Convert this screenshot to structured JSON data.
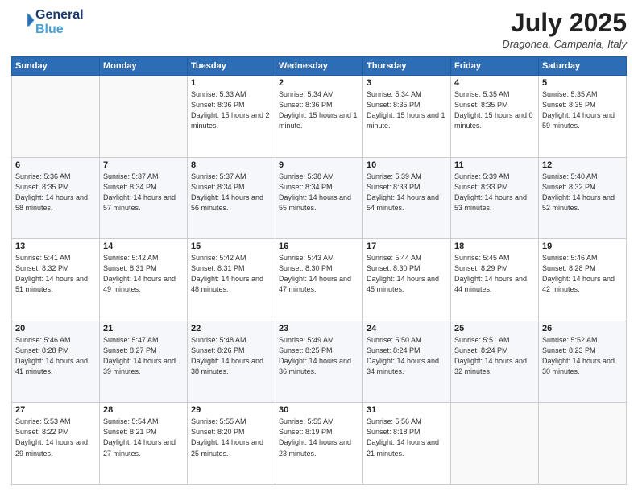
{
  "logo": {
    "line1": "General",
    "line2": "Blue"
  },
  "title": "July 2025",
  "location": "Dragonea, Campania, Italy",
  "days_of_week": [
    "Sunday",
    "Monday",
    "Tuesday",
    "Wednesday",
    "Thursday",
    "Friday",
    "Saturday"
  ],
  "weeks": [
    [
      {
        "day": "",
        "info": ""
      },
      {
        "day": "",
        "info": ""
      },
      {
        "day": "1",
        "info": "Sunrise: 5:33 AM\nSunset: 8:36 PM\nDaylight: 15 hours\nand 2 minutes."
      },
      {
        "day": "2",
        "info": "Sunrise: 5:34 AM\nSunset: 8:36 PM\nDaylight: 15 hours\nand 1 minute."
      },
      {
        "day": "3",
        "info": "Sunrise: 5:34 AM\nSunset: 8:35 PM\nDaylight: 15 hours\nand 1 minute."
      },
      {
        "day": "4",
        "info": "Sunrise: 5:35 AM\nSunset: 8:35 PM\nDaylight: 15 hours\nand 0 minutes."
      },
      {
        "day": "5",
        "info": "Sunrise: 5:35 AM\nSunset: 8:35 PM\nDaylight: 14 hours\nand 59 minutes."
      }
    ],
    [
      {
        "day": "6",
        "info": "Sunrise: 5:36 AM\nSunset: 8:35 PM\nDaylight: 14 hours\nand 58 minutes."
      },
      {
        "day": "7",
        "info": "Sunrise: 5:37 AM\nSunset: 8:34 PM\nDaylight: 14 hours\nand 57 minutes."
      },
      {
        "day": "8",
        "info": "Sunrise: 5:37 AM\nSunset: 8:34 PM\nDaylight: 14 hours\nand 56 minutes."
      },
      {
        "day": "9",
        "info": "Sunrise: 5:38 AM\nSunset: 8:34 PM\nDaylight: 14 hours\nand 55 minutes."
      },
      {
        "day": "10",
        "info": "Sunrise: 5:39 AM\nSunset: 8:33 PM\nDaylight: 14 hours\nand 54 minutes."
      },
      {
        "day": "11",
        "info": "Sunrise: 5:39 AM\nSunset: 8:33 PM\nDaylight: 14 hours\nand 53 minutes."
      },
      {
        "day": "12",
        "info": "Sunrise: 5:40 AM\nSunset: 8:32 PM\nDaylight: 14 hours\nand 52 minutes."
      }
    ],
    [
      {
        "day": "13",
        "info": "Sunrise: 5:41 AM\nSunset: 8:32 PM\nDaylight: 14 hours\nand 51 minutes."
      },
      {
        "day": "14",
        "info": "Sunrise: 5:42 AM\nSunset: 8:31 PM\nDaylight: 14 hours\nand 49 minutes."
      },
      {
        "day": "15",
        "info": "Sunrise: 5:42 AM\nSunset: 8:31 PM\nDaylight: 14 hours\nand 48 minutes."
      },
      {
        "day": "16",
        "info": "Sunrise: 5:43 AM\nSunset: 8:30 PM\nDaylight: 14 hours\nand 47 minutes."
      },
      {
        "day": "17",
        "info": "Sunrise: 5:44 AM\nSunset: 8:30 PM\nDaylight: 14 hours\nand 45 minutes."
      },
      {
        "day": "18",
        "info": "Sunrise: 5:45 AM\nSunset: 8:29 PM\nDaylight: 14 hours\nand 44 minutes."
      },
      {
        "day": "19",
        "info": "Sunrise: 5:46 AM\nSunset: 8:28 PM\nDaylight: 14 hours\nand 42 minutes."
      }
    ],
    [
      {
        "day": "20",
        "info": "Sunrise: 5:46 AM\nSunset: 8:28 PM\nDaylight: 14 hours\nand 41 minutes."
      },
      {
        "day": "21",
        "info": "Sunrise: 5:47 AM\nSunset: 8:27 PM\nDaylight: 14 hours\nand 39 minutes."
      },
      {
        "day": "22",
        "info": "Sunrise: 5:48 AM\nSunset: 8:26 PM\nDaylight: 14 hours\nand 38 minutes."
      },
      {
        "day": "23",
        "info": "Sunrise: 5:49 AM\nSunset: 8:25 PM\nDaylight: 14 hours\nand 36 minutes."
      },
      {
        "day": "24",
        "info": "Sunrise: 5:50 AM\nSunset: 8:24 PM\nDaylight: 14 hours\nand 34 minutes."
      },
      {
        "day": "25",
        "info": "Sunrise: 5:51 AM\nSunset: 8:24 PM\nDaylight: 14 hours\nand 32 minutes."
      },
      {
        "day": "26",
        "info": "Sunrise: 5:52 AM\nSunset: 8:23 PM\nDaylight: 14 hours\nand 30 minutes."
      }
    ],
    [
      {
        "day": "27",
        "info": "Sunrise: 5:53 AM\nSunset: 8:22 PM\nDaylight: 14 hours\nand 29 minutes."
      },
      {
        "day": "28",
        "info": "Sunrise: 5:54 AM\nSunset: 8:21 PM\nDaylight: 14 hours\nand 27 minutes."
      },
      {
        "day": "29",
        "info": "Sunrise: 5:55 AM\nSunset: 8:20 PM\nDaylight: 14 hours\nand 25 minutes."
      },
      {
        "day": "30",
        "info": "Sunrise: 5:55 AM\nSunset: 8:19 PM\nDaylight: 14 hours\nand 23 minutes."
      },
      {
        "day": "31",
        "info": "Sunrise: 5:56 AM\nSunset: 8:18 PM\nDaylight: 14 hours\nand 21 minutes."
      },
      {
        "day": "",
        "info": ""
      },
      {
        "day": "",
        "info": ""
      }
    ]
  ]
}
